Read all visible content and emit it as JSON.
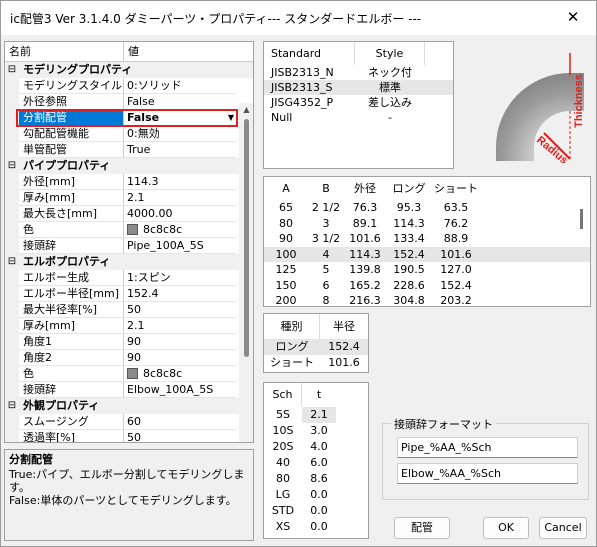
{
  "window": {
    "title": "ic配管3 Ver 3.1.4.0 ダミーパーツ・プロパティ--- スタンダードエルボー ---",
    "close": "✕"
  },
  "grid": {
    "header_name": "名前",
    "header_value": "値",
    "modeling": {
      "title": "モデリングプロパティ",
      "rows": [
        {
          "k": "モデリングスタイル",
          "v": "0:ソリッド"
        },
        {
          "k": "外径参照",
          "v": "False"
        },
        {
          "k": "分割配管",
          "v": "False"
        },
        {
          "k": "勾配配管機能",
          "v": "0:無効"
        },
        {
          "k": "単管配管",
          "v": "True"
        }
      ]
    },
    "pipe": {
      "title": "パイププロパティ",
      "rows": [
        {
          "k": "外径[mm]",
          "v": "114.3"
        },
        {
          "k": "厚み[mm]",
          "v": "2.1"
        },
        {
          "k": "最大長さ[mm]",
          "v": "4000.00"
        },
        {
          "k": "色",
          "v": "8c8c8c"
        },
        {
          "k": "接頭辞",
          "v": "Pipe_100A_5S"
        }
      ]
    },
    "elbow": {
      "title": "エルボプロパティ",
      "rows": [
        {
          "k": "エルボー生成",
          "v": "1:スピン"
        },
        {
          "k": "エルボー半径[mm]",
          "v": "152.4"
        },
        {
          "k": "最大半径率[%]",
          "v": "50"
        },
        {
          "k": "厚み[mm]",
          "v": "2.1"
        },
        {
          "k": "角度1",
          "v": "90"
        },
        {
          "k": "角度2",
          "v": "90"
        },
        {
          "k": "色",
          "v": "8c8c8c"
        },
        {
          "k": "接頭辞",
          "v": "Elbow_100A_5S"
        }
      ]
    },
    "appearance": {
      "title": "外観プロパティ",
      "rows": [
        {
          "k": "スムージング",
          "v": "60"
        },
        {
          "k": "透過率[%]",
          "v": "50"
        }
      ]
    },
    "toggle": "⊟"
  },
  "description": {
    "title": "分割配管",
    "line1": "True:パイプ、エルボー分割してモデリングします。",
    "line2": "False:単体のパーツとしてモデリングします。"
  },
  "standard": {
    "headers": [
      "Standard",
      "Style"
    ],
    "rows": [
      [
        "JISB2313_N",
        "ネック付"
      ],
      [
        "JISB2313_S",
        "標準"
      ],
      [
        "JISG4352_P",
        "差し込み"
      ],
      [
        "Null",
        "-"
      ]
    ]
  },
  "elbow_image": {
    "thickness": "Thickness",
    "radius": "Radius",
    "accent": "#e0201a",
    "body": "#909090"
  },
  "dimensions": {
    "headers": [
      "A",
      "B",
      "外径",
      "ロング",
      "ショート"
    ],
    "rows": [
      [
        "65",
        "2 1/2",
        "76.3",
        "95.3",
        "63.5"
      ],
      [
        "80",
        "3",
        "89.1",
        "114.3",
        "76.2"
      ],
      [
        "90",
        "3 1/2",
        "101.6",
        "133.4",
        "88.9"
      ],
      [
        "100",
        "4",
        "114.3",
        "152.4",
        "101.6"
      ],
      [
        "125",
        "5",
        "139.8",
        "190.5",
        "127.0"
      ],
      [
        "150",
        "6",
        "165.2",
        "228.6",
        "152.4"
      ],
      [
        "200",
        "8",
        "216.3",
        "304.8",
        "203.2"
      ]
    ]
  },
  "radius": {
    "headers": [
      "種別",
      "半径"
    ],
    "rows": [
      [
        "ロング",
        "152.4"
      ],
      [
        "ショート",
        "101.6"
      ]
    ]
  },
  "schedule": {
    "headers": [
      "Sch",
      "t"
    ],
    "rows": [
      [
        "5S",
        "2.1"
      ],
      [
        "10S",
        "3.0"
      ],
      [
        "20S",
        "4.0"
      ],
      [
        "40",
        "6.0"
      ],
      [
        "80",
        "8.6"
      ],
      [
        "LG",
        "0.0"
      ],
      [
        "STD",
        "0.0"
      ],
      [
        "XS",
        "0.0"
      ]
    ]
  },
  "prefix_format": {
    "title": "接頭辞フォーマット",
    "pipe": "Pipe_%AA_%Sch",
    "elbow": "Elbow_%AA_%Sch"
  },
  "buttons": {
    "piping": "配管",
    "ok": "OK",
    "cancel": "Cancel"
  }
}
